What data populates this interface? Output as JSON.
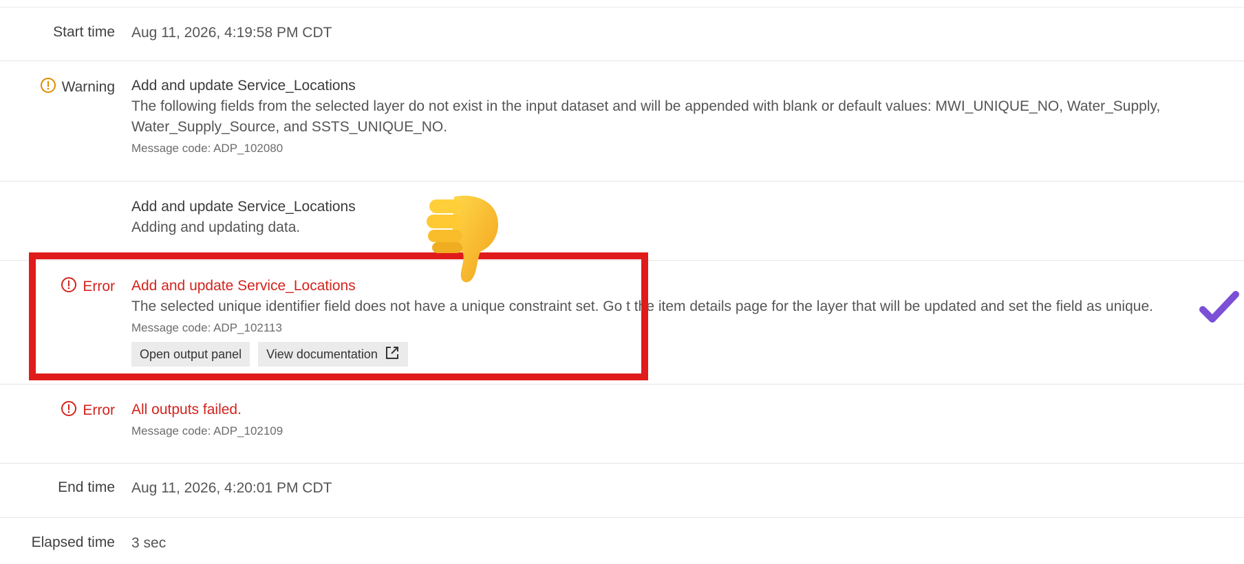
{
  "start": {
    "label": "Start time",
    "value": "Aug 11, 2026, 4:19:58 PM CDT"
  },
  "warning": {
    "label": "Warning",
    "title": "Add and update Service_Locations",
    "desc_line1": "The following fields from the selected layer do not exist in the input dataset and will be appended with blank or default values: MWI_UNIQUE_NO, Water_Supply,",
    "desc_line2": "Water_Supply_Source, and SSTS_UNIQUE_NO.",
    "code": "Message code: ADP_102080"
  },
  "info": {
    "title": "Add and update Service_Locations",
    "desc": "Adding and updating data."
  },
  "error1": {
    "label": "Error",
    "title": "Add and update Service_Locations",
    "desc_a": "The selected unique identifier field does not have a unique constraint set. Go t",
    "desc_b": " the item details page for the layer that will be updated and set the field as unique.",
    "code": "Message code: ADP_102113",
    "btn_output": "Open output panel",
    "btn_docs": "View documentation"
  },
  "error2": {
    "label": "Error",
    "title": "All outputs failed.",
    "code": "Message code: ADP_102109"
  },
  "end": {
    "label": "End time",
    "value": "Aug 11, 2026, 4:20:01 PM CDT"
  },
  "elapsed": {
    "label": "Elapsed time",
    "value": "3 sec"
  },
  "icons": {
    "warning": "warning-circle-icon",
    "error": "error-circle-icon",
    "external": "external-link-icon",
    "thumb": "thumbs-down-icon",
    "check": "checkmark-icon"
  },
  "colors": {
    "error": "#d3231c",
    "warning": "#e08a00",
    "highlight": "#e01b1b",
    "check": "#7b4fd6"
  }
}
